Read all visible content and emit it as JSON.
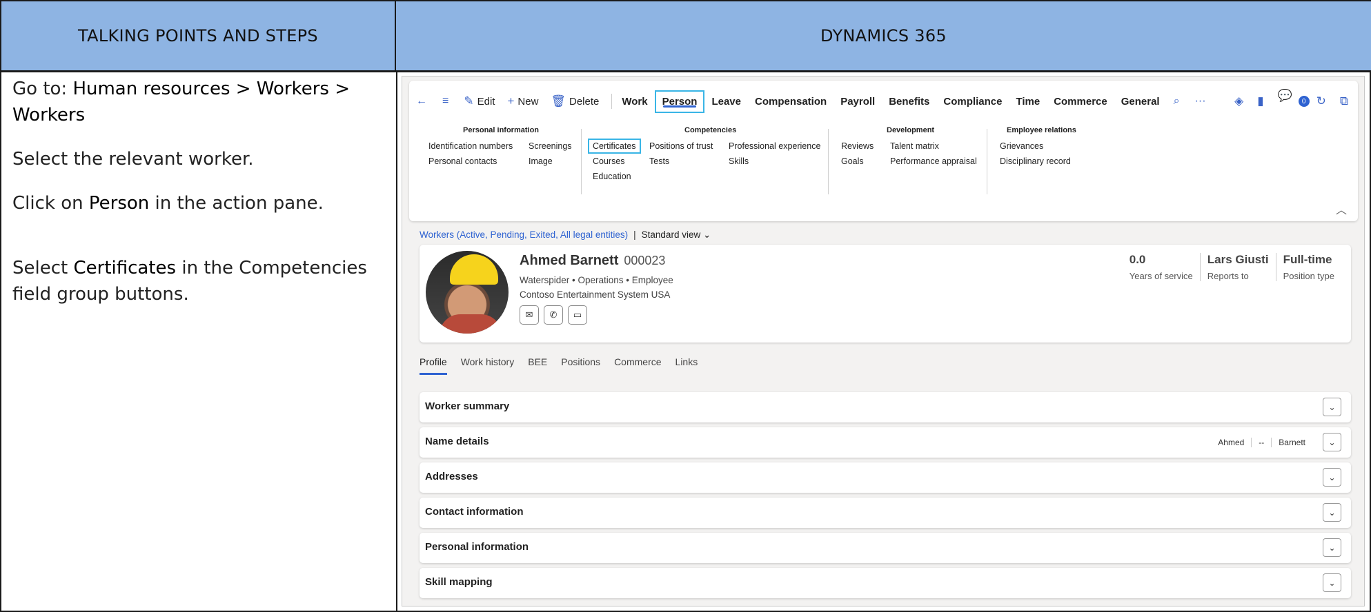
{
  "document": {
    "left_header": "TALKING POINTS AND STEPS",
    "right_header": "DYNAMICS 365",
    "steps": {
      "step1_prefix": "Go to: ",
      "step1_bold": "Human resources > Workers > Workers",
      "step2": "Select the relevant worker.",
      "step3_prefix": "Click on ",
      "step3_bold": "Person",
      "step3_suffix": " in the action pane.",
      "step4_prefix": "Select ",
      "step4_bold": "Certificates",
      "step4_suffix": " in the Competencies field group buttons."
    }
  },
  "toolbar": {
    "back_icon": "arrow-left-icon",
    "menu_icon": "hamburger-icon",
    "edit_label": "Edit",
    "new_label": "New",
    "delete_label": "Delete",
    "tabs": [
      "Work",
      "Person",
      "Leave",
      "Compensation",
      "Payroll",
      "Benefits",
      "Compliance",
      "Time",
      "Commerce",
      "General"
    ],
    "active_tab": "Person",
    "more_label": "···",
    "notification_count": "0"
  },
  "groups": {
    "personal": {
      "title": "Personal information",
      "items": [
        "Identification numbers",
        "Personal contacts",
        "Screenings",
        "Image"
      ]
    },
    "competencies": {
      "title": "Competencies",
      "items": [
        "Certificates",
        "Courses",
        "Education",
        "Positions of trust",
        "Tests",
        "Professional experience",
        "Skills"
      ]
    },
    "development": {
      "title": "Development",
      "items": [
        "Reviews",
        "Goals",
        "Talent matrix",
        "Performance appraisal"
      ]
    },
    "relations": {
      "title": "Employee relations",
      "items": [
        "Grievances",
        "Disciplinary record"
      ]
    }
  },
  "breadcrumb": {
    "link": "Workers (Active, Pending, Exited, All legal entities)",
    "separator": "|",
    "view": "Standard view"
  },
  "worker": {
    "name": "Ahmed Barnett",
    "number": "000023",
    "subtitle": "Waterspider  •  Operations  •  Employee",
    "company": "Contoso Entertainment System USA",
    "stats": [
      {
        "value": "0.0",
        "label": "Years of service"
      },
      {
        "value": "Lars Giusti",
        "label": "Reports to"
      },
      {
        "value": "Full-time",
        "label": "Position type"
      }
    ]
  },
  "tabs": [
    "Profile",
    "Work history",
    "BEE",
    "Positions",
    "Commerce",
    "Links"
  ],
  "fasttabs": {
    "worker_summary": "Worker summary",
    "name_details": "Name details",
    "name_first": "Ahmed",
    "name_middle": "--",
    "name_last": "Barnett",
    "addresses": "Addresses",
    "contact_information": "Contact information",
    "personal_information": "Personal information",
    "skill_mapping": "Skill mapping"
  }
}
